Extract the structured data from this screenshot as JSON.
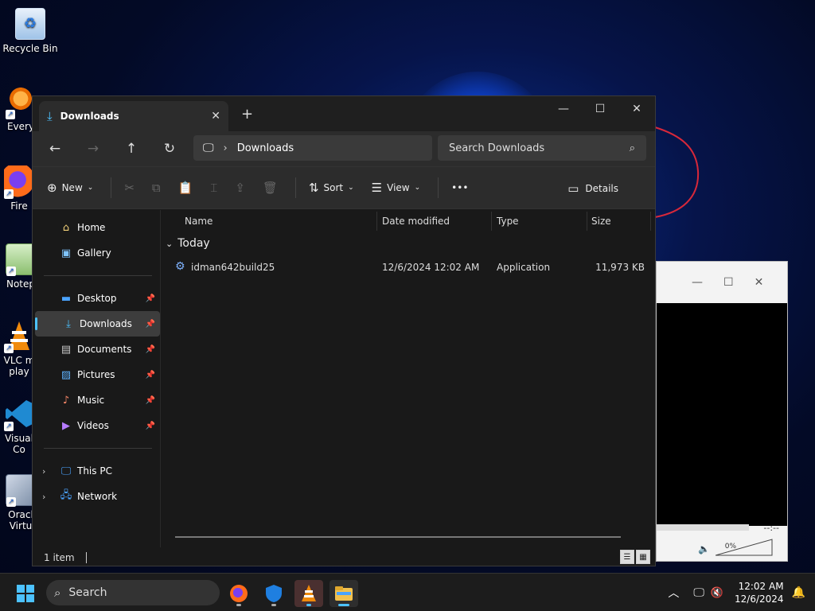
{
  "desktop": {
    "icons": [
      {
        "label": "Recycle Bin"
      },
      {
        "label": "Every"
      },
      {
        "label": "Fire"
      },
      {
        "label": "Notep"
      },
      {
        "label": "VLC m",
        "label2": "play"
      },
      {
        "label": "Visual",
        "label2": "Co"
      },
      {
        "label": "Oracl",
        "label2": "Virtu"
      }
    ]
  },
  "media_player": {
    "time": "--:--",
    "volume_percent": "0%"
  },
  "explorer": {
    "tab_title": "Downloads",
    "breadcrumb": [
      "Downloads"
    ],
    "search_placeholder": "Search Downloads",
    "toolbar": {
      "new_label": "New",
      "sort_label": "Sort",
      "view_label": "View",
      "more_label": "•••",
      "details_label": "Details"
    },
    "nav": {
      "home": "Home",
      "gallery": "Gallery",
      "desktop": "Desktop",
      "downloads": "Downloads",
      "documents": "Documents",
      "pictures": "Pictures",
      "music": "Music",
      "videos": "Videos",
      "this_pc": "This PC",
      "network": "Network"
    },
    "columns": {
      "name": "Name",
      "date_modified": "Date modified",
      "type": "Type",
      "size": "Size"
    },
    "group_label": "Today",
    "files": [
      {
        "name": "idman642build25",
        "date_modified": "12/6/2024 12:02 AM",
        "type": "Application",
        "size": "11,973 KB"
      }
    ],
    "status_text": "1 item"
  },
  "taskbar": {
    "search_label": "Search",
    "clock_time": "12:02 AM",
    "clock_date": "12/6/2024"
  },
  "colors": {
    "accent": "#4cc2ff",
    "window_bg": "#191919",
    "toolbar_bg": "#2c2c2c"
  }
}
